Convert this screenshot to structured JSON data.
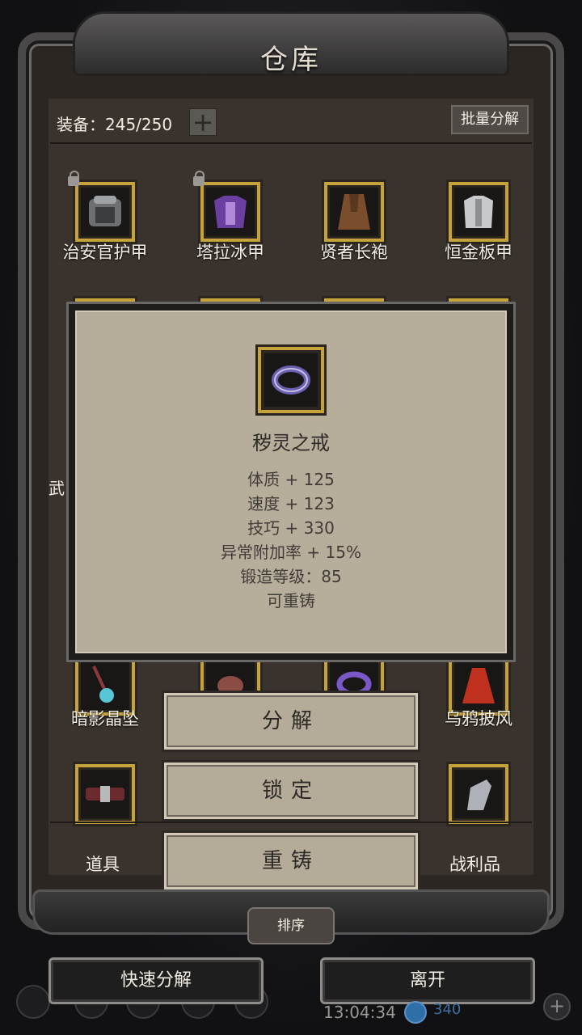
{
  "window": {
    "title": "仓库"
  },
  "header": {
    "equip_count": "装备：245/250",
    "expand_label": "+",
    "batch_label": "批量分解"
  },
  "grid": {
    "row1": [
      {
        "label": "治安官护甲",
        "icon": "black-armor-icon",
        "locked": true
      },
      {
        "label": "塔拉冰甲",
        "icon": "purple-armor-icon",
        "locked": true
      },
      {
        "label": "贤者长袍",
        "icon": "brown-robe-icon",
        "locked": false
      },
      {
        "label": "恒金板甲",
        "icon": "silver-plate-icon",
        "locked": false
      }
    ],
    "row5": [
      {
        "label": "暗影晶坠",
        "icon": "pendant-icon"
      },
      {
        "label": "",
        "icon": "scroll-icon"
      },
      {
        "label": "",
        "icon": "ring-icon"
      },
      {
        "label": "乌鸦披风",
        "icon": "red-cloak-icon"
      }
    ],
    "row6": [
      {
        "icon": "belt-icon"
      },
      {
        "icon": "gauntlet-icon"
      }
    ],
    "partial_left_text": "武"
  },
  "tooltip": {
    "name": "秽灵之戒",
    "icon": "purple-ring-icon",
    "stats": [
      "体质 + 125",
      "速度 + 123",
      "技巧 + 330",
      "异常附加率 + 15%",
      "锻造等级：85",
      "可重铸"
    ]
  },
  "actions": {
    "decompose": "分解",
    "lock": "锁定",
    "reforge": "重铸"
  },
  "tabs": {
    "items": "道具",
    "loot": "战利品"
  },
  "sort_label": "排序",
  "footer": {
    "quick_decompose": "快速分解",
    "leave": "离开",
    "clock": "13:04:34",
    "coins": "340"
  },
  "colors": {
    "slot_gold": "#c6a23a",
    "tooltip_bg": "#b7ad9b",
    "frame": "#4a4848"
  }
}
